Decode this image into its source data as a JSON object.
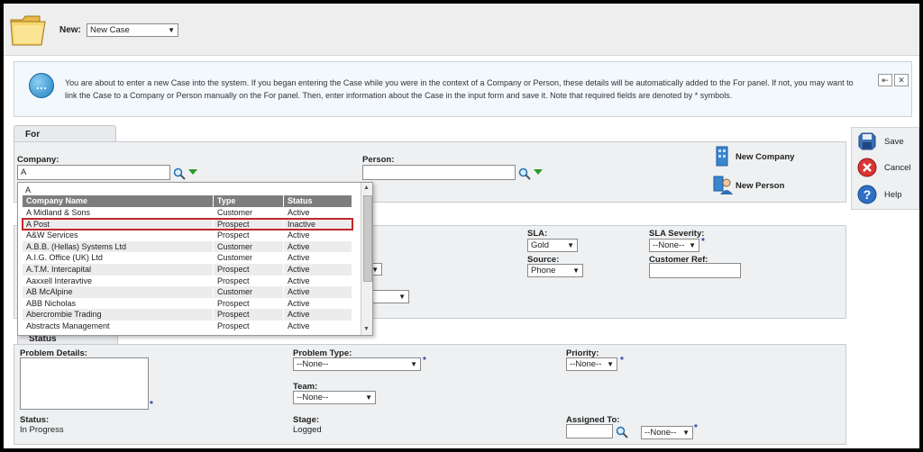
{
  "header": {
    "new_label": "New:",
    "new_select": "New Case"
  },
  "info": {
    "text": "You are about to enter a new Case into the system. If you began entering the Case while you were in the context of a Company or Person, these details will be automatically added to the For panel. If not, you may want to link the Case to a Company or Person manually on the For panel. Then, enter information about the Case in the input form and save it. Note that required fields are denoted by * symbols."
  },
  "for_panel": {
    "tab": "For",
    "company_label": "Company:",
    "company_value": "A",
    "person_label": "Person:",
    "person_value": "",
    "new_company": "New Company",
    "new_person": "New Person"
  },
  "dropdown": {
    "query": "A",
    "headers": [
      "Company Name",
      "Type",
      "Status"
    ],
    "rows": [
      {
        "name": "A Midland & Sons",
        "type": "Customer",
        "status": "Active"
      },
      {
        "name": "A Post",
        "type": "Prospect",
        "status": "Inactive"
      },
      {
        "name": "A&W Services",
        "type": "Prospect",
        "status": "Active"
      },
      {
        "name": "A.B.B. (Hellas) Systems Ltd",
        "type": "Customer",
        "status": "Active"
      },
      {
        "name": "A.I.G. Office (UK) Ltd",
        "type": "Customer",
        "status": "Active"
      },
      {
        "name": "A.T.M. Intercapital",
        "type": "Prospect",
        "status": "Active"
      },
      {
        "name": "Aaxxell Interavtive",
        "type": "Prospect",
        "status": "Active"
      },
      {
        "name": "AB McAlpine",
        "type": "Customer",
        "status": "Active"
      },
      {
        "name": "ABB Nicholas",
        "type": "Prospect",
        "status": "Active"
      },
      {
        "name": "Abercrombie Trading",
        "type": "Prospect",
        "status": "Active"
      },
      {
        "name": "Abstracts Management",
        "type": "Prospect",
        "status": "Active"
      }
    ]
  },
  "case_panel": {
    "sla_label": "SLA:",
    "sla_value": "Gold",
    "sla_severity_label": "SLA Severity:",
    "sla_severity_value": "--None--",
    "source_label": "Source:",
    "source_value": "Phone",
    "customer_ref_label": "Customer Ref:",
    "customer_ref_value": ""
  },
  "status_panel": {
    "tab": "Status",
    "problem_details_label": "Problem Details:",
    "problem_type_label": "Problem Type:",
    "problem_type_value": "--None--",
    "priority_label": "Priority:",
    "priority_value": "--None--",
    "team_label": "Team:",
    "team_value": "--None--",
    "status_label": "Status:",
    "status_value": "In Progress",
    "stage_label": "Stage:",
    "stage_value": "Logged",
    "assigned_label": "Assigned To:",
    "assigned_value": "--None--"
  },
  "sidebar": {
    "save": "Save",
    "cancel": "Cancel",
    "help": "Help"
  },
  "colors": {
    "accent_green": "#2a9a2a",
    "highlight_red": "#c0282a",
    "required_blue": "#2a3fb0"
  }
}
